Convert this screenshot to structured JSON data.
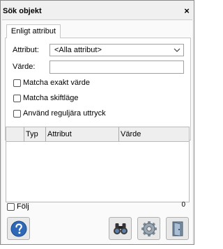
{
  "window": {
    "title": "Sök objekt",
    "close_glyph": "×"
  },
  "tabs": [
    {
      "label": "Enligt attribut"
    }
  ],
  "form": {
    "attribute_label": "Attribut:",
    "attribute_value": "<Alla attribut>",
    "value_label": "Värde:",
    "value_text": ""
  },
  "options": [
    {
      "label": "Matcha exakt värde",
      "checked": false
    },
    {
      "label": "Matcha skiftläge",
      "checked": false
    },
    {
      "label": "Använd reguljära uttryck",
      "checked": false
    }
  ],
  "results": {
    "columns": [
      "Typ",
      "Attribut",
      "Värde"
    ],
    "rows": []
  },
  "footer": {
    "follow_label": "Följ",
    "follow_checked": false,
    "count": "0"
  },
  "icons": {
    "help": "help-icon",
    "search": "binoculars-icon",
    "settings": "gear-icon",
    "exit": "door-icon"
  }
}
